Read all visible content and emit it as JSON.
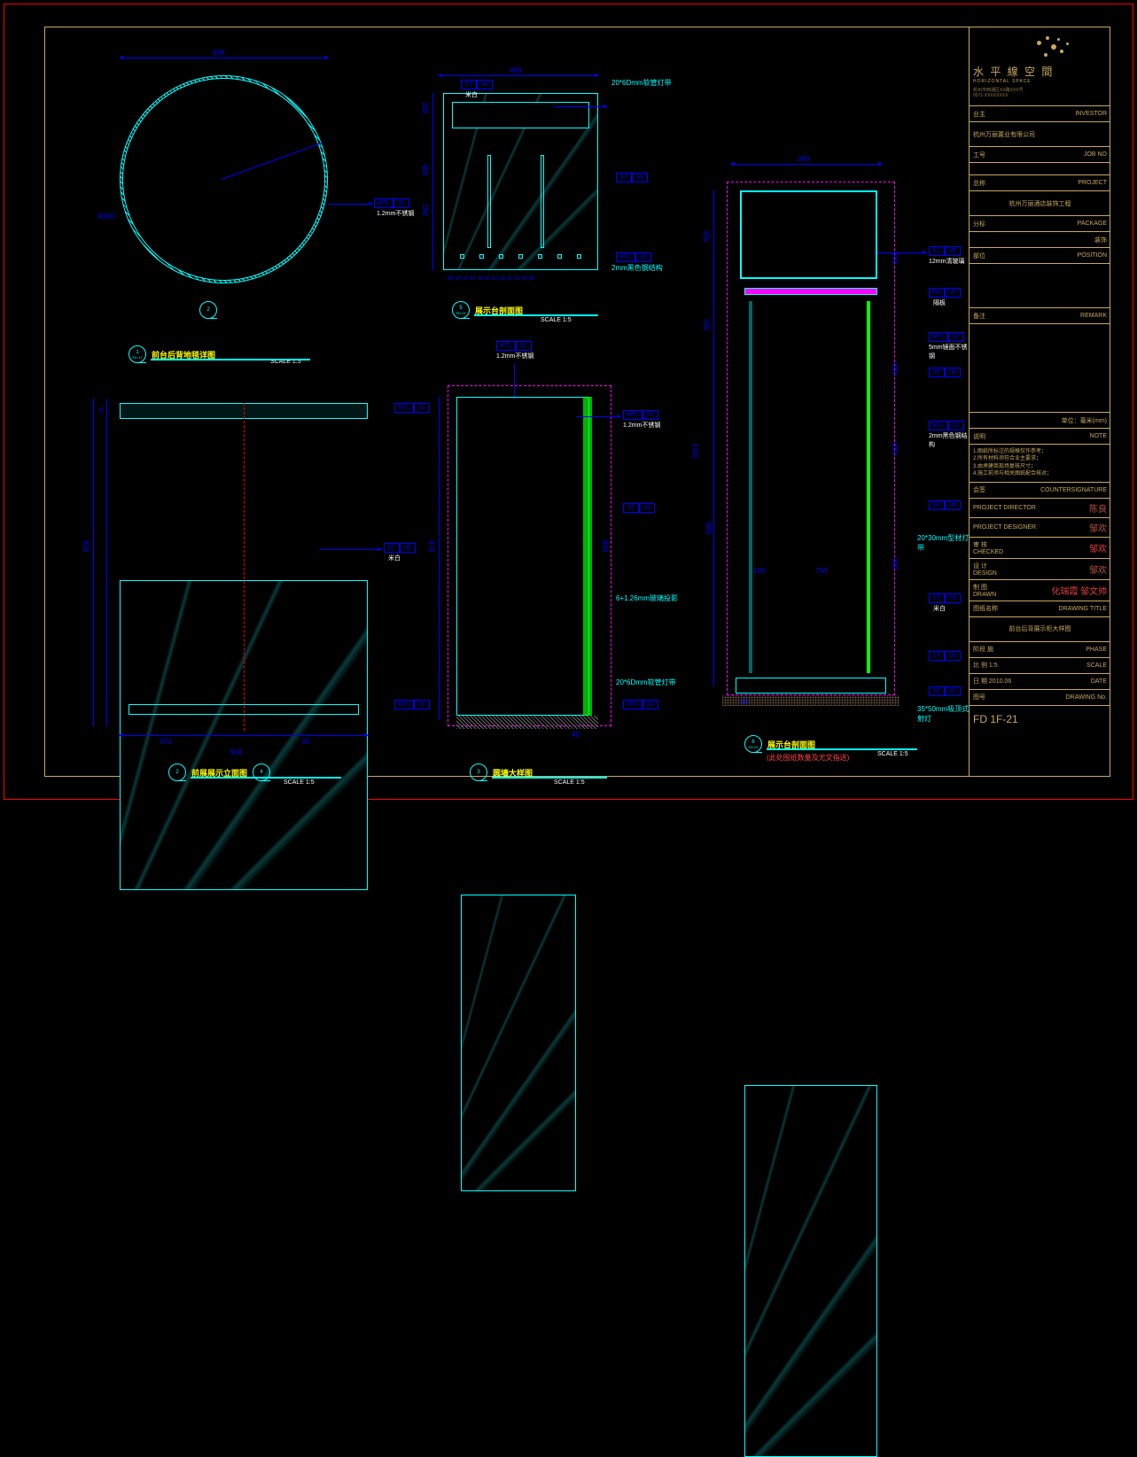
{
  "company": {
    "cn": "水 平 線 空 間",
    "en": "HORIZONTAL SPACE",
    "addr1": "杭州市西湖区XX路XXX号",
    "tel": "0571-XXXXXXXX"
  },
  "titleblock": {
    "investor_lbl": "业主",
    "investor": "INVESTOR",
    "investor_val": "杭州万丽置业有限公司",
    "jobno_lbl": "工号",
    "jobno": "JOB NO",
    "project_lbl": "总称",
    "project": "PROJECT",
    "project_val": "杭州万丽酒店装饰工程",
    "package_lbl": "分标",
    "package": "PACKAGE",
    "package_val": "装饰",
    "position_lbl": "部位",
    "position": "POSITION",
    "remark_lbl": "备注",
    "remark": "REMARK",
    "unit": "单位：毫米(mm)",
    "note_lbl": "说明",
    "note": "NOTE",
    "notes": "1.图纸所标注的规格仅作参考；\n2.所有材料须符合业主要求；\n3.由承建商现场复核尺寸；\n4.施工前须与相关图纸配合核对；",
    "cs_lbl": "会签",
    "cs": "COUNTERSIGNATURE",
    "pd": "PROJECT DIRECTOR",
    "pdes": "PROJECT DESIGNER",
    "chk_lbl": "审 核",
    "chk": "CHECKED",
    "des_lbl": "设 计",
    "des": "DESIGN",
    "drw_lbl": "制 图",
    "drw": "DRAWN",
    "dt_lbl": "图纸名称",
    "dt": "DRAWING TITLE",
    "drawing_title": "前台后背展示柜大样图",
    "phase_lbl": "阶段",
    "phase": "PHASE",
    "phase_val": "施",
    "scale_lbl": "比 例",
    "scale": "SCALE",
    "scale_val": "1:5",
    "date_lbl": "日 期",
    "date": "DATE",
    "date_val": "2010.06",
    "dwgno_lbl": "图号",
    "dwgno": "DRAWING No.",
    "dwgno_val": "FD 1F-21",
    "sig1": "陈良",
    "sig2": "邹欢",
    "sig3": "邹欢",
    "sig4": "化瑞霞 邹文帅"
  },
  "views": {
    "v1": {
      "num": "1",
      "ref": "FD-17",
      "title": "前台后背地毯详图",
      "scale": "SCALE  1:5"
    },
    "v2": {
      "num": "2",
      "ref": "FD-17",
      "title": "前展展示立面图",
      "scale": "SCALE  1:5"
    },
    "v3": {
      "num": "3",
      "ref": "FD-17",
      "title": "圆墙大样图",
      "scale": "SCALE  1:5"
    },
    "v4": {
      "num": "4",
      "ref": "FD-17"
    },
    "v5": {
      "num": "5",
      "ref": "FD-21",
      "title": "展示台剖面图",
      "scale": "SCALE  1:5"
    },
    "v6": {
      "num": "6",
      "ref": "FD-21",
      "title": "展示台剖面图",
      "scale": "SCALE  1:5",
      "note": "(此处图纸数量及尤文指送)"
    }
  },
  "dims": {
    "d600": "600",
    "r300": "R300",
    "d400": "400",
    "d100": "100",
    "d25": "25",
    "d450": "450",
    "d250": "250",
    "d50": "50",
    "d65": "65",
    "d10": "10",
    "d15": "15",
    "d570": "570",
    "d800": "800",
    "d870": "870",
    "d40": "40",
    "d340": "340",
    "d20": "20",
    "d530": "530",
    "d1330": "1330",
    "d665": "665",
    "d300": "300",
    "d350": "350",
    "d430": "430",
    "d750": "750",
    "d100b": "100",
    "d650": "650",
    "d30": "30"
  },
  "tags": {
    "mtl01": {
      "a": "MTL",
      "b": "01",
      "note": "1.2mm不锈钢"
    },
    "mtl02": {
      "a": "MTL",
      "b": "02",
      "note": "2mm黑色钢结构"
    },
    "mtl07": {
      "a": "MTL",
      "b": "07",
      "note": "5mm镜面不锈钢"
    },
    "st05": {
      "a": "ST",
      "b": "05",
      "note": "米白"
    },
    "st09": {
      "a": "ST",
      "b": "09",
      "note": ""
    },
    "sf05": {
      "a": "SF",
      "b": "05",
      "note": ""
    },
    "sf04": {
      "a": "SF",
      "b": "04",
      "note": ""
    },
    "cl05": {
      "a": "CL",
      "b": "05",
      "note": "12mm清玻璃"
    },
    "pg07": {
      "a": "PG",
      "b": "07",
      "note": "隔板"
    },
    "led": "20*6Dmm软管灯带",
    "led2": "20*30mm型材灯带",
    "led3": "35*50mm吸顶式射灯",
    "glass": "6+1.26mm玻璃投影"
  }
}
